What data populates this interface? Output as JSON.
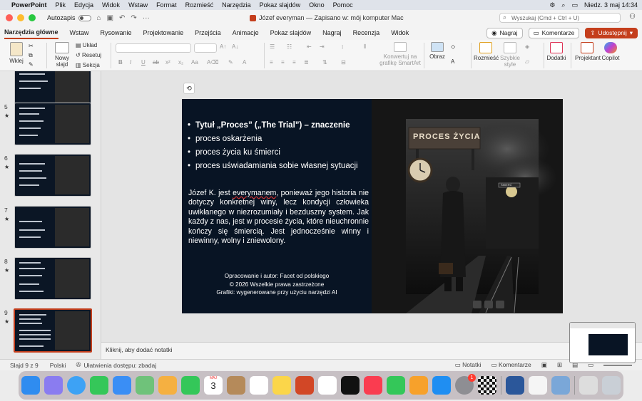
{
  "menubar": {
    "app_name": "PowerPoint",
    "items": [
      "Plik",
      "Edycja",
      "Widok",
      "Wstaw",
      "Format",
      "Rozmieść",
      "Narzędzia",
      "Pokaz slajdów",
      "Okno",
      "Pomoc"
    ],
    "datetime": "Niedz. 3 maj  14:34"
  },
  "titlebar": {
    "autosave_label": "Autozapis",
    "document_title": "Józef everyman — Zapisano w: mój komputer Mac",
    "search_placeholder": "Wyszukaj (Cmd + Ctrl + U)"
  },
  "ribbon_tabs": [
    "Narzędzia główne",
    "Wstaw",
    "Rysowanie",
    "Projektowanie",
    "Przejścia",
    "Animacje",
    "Pokaz slajdów",
    "Nagraj",
    "Recenzja",
    "Widok"
  ],
  "actions": {
    "record": "Nagraj",
    "comments": "Komentarze",
    "share": "Udostępnij"
  },
  "ribbon": {
    "paste": "Wklej",
    "new_slide": "Nowy slajd",
    "layout": "Układ",
    "reset": "Resetuj",
    "section": "Sekcja",
    "smartart": "Konwertuj na grafikę SmartArt",
    "picture": "Obraz",
    "arrange": "Rozmieść",
    "quick_styles": "Szybkie style",
    "addins": "Dodatki",
    "designer": "Projektant",
    "copilot": "Copilot"
  },
  "thumbnails": [
    {
      "number": "",
      "star": false
    },
    {
      "number": "5",
      "star": true
    },
    {
      "number": "6",
      "star": true
    },
    {
      "number": "7",
      "star": true
    },
    {
      "number": "8",
      "star": true
    },
    {
      "number": "9",
      "star": true,
      "selected": true
    }
  ],
  "slide": {
    "bullets": [
      "Tytuł „Proces” („The Trial”) – znaczenie",
      "proces oskarżenia",
      "proces życia ku śmierci",
      "proces uświadamiania sobie własnej sytuacji"
    ],
    "paragraph_before": "Józef K. jest ",
    "paragraph_underlined": "everymanem",
    "paragraph_after": ", ponieważ jego historia nie dotyczy konkretnej winy, lecz kondycji człowieka uwikłanego w niezrozumiały i bezduszny system. Jak każdy z nas, jest w procesie życia, które nieuchronnie kończy się śmiercią. Jest jednocześnie winny i niewinny, wolny i zniewolony.",
    "credit_line1": "Opracowanie i autor: Facet od polskiego",
    "credit_line2": "© 2026 Wszelkie prawa zastrzeżone",
    "credit_line3": "Grafiki: wygenerowane przy użyciu narzędzi AI",
    "image_sign": "PROCES ŻYCIA",
    "image_train_sign": "ŚMIERĆ"
  },
  "notes_placeholder": "Kliknij, aby dodać notatki",
  "statusbar": {
    "slide_counter": "Slajd 9 z 9",
    "language": "Polski",
    "accessibility": "Ułatwienia dostępu: zbadaj",
    "notes": "Notatki",
    "comments": "Komentarze"
  },
  "dock": {
    "calendar_month": "MAJ",
    "calendar_day": "3",
    "badge": "1"
  },
  "colors": {
    "accent": "#c43e1c",
    "slide_bg": "#081424"
  }
}
